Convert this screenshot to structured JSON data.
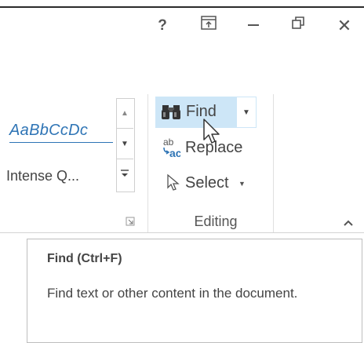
{
  "title_bar": {
    "help_label": "?",
    "ribbon_display_icon": "ribbon-display-options-icon",
    "minimize_icon": "minimize-icon",
    "restore_icon": "restore-icon",
    "close_label": "✕"
  },
  "styles_gallery": {
    "sample_text": "AaBbCcDc",
    "style_name": "Intense Q..."
  },
  "editing": {
    "find_label": "Find",
    "replace_label": "Replace",
    "select_label": "Select",
    "group_label": "Editing"
  },
  "tooltip": {
    "title": "Find (Ctrl+F)",
    "body": "Find text or other content in the document."
  },
  "colors": {
    "accent": "#2e74b5",
    "hover_bg": "#cde6f7"
  }
}
